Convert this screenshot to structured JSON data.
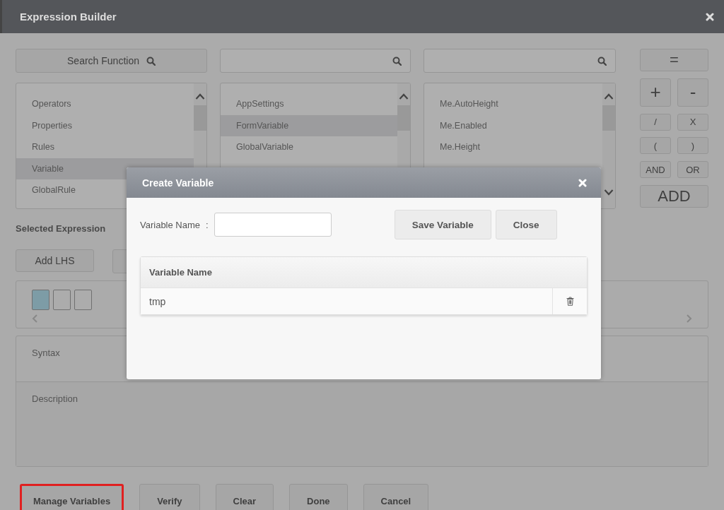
{
  "window": {
    "title": "Expression Builder"
  },
  "search_function": {
    "label": "Search Function"
  },
  "lists": [
    {
      "items": [
        {
          "label": "Operators",
          "selected": false
        },
        {
          "label": "Properties",
          "selected": false
        },
        {
          "label": "Rules",
          "selected": false
        },
        {
          "label": "Variable",
          "selected": true
        },
        {
          "label": "GlobalRule",
          "selected": false
        }
      ]
    },
    {
      "items": [
        {
          "label": "AppSettings",
          "selected": false
        },
        {
          "label": "FormVariable",
          "selected": true
        },
        {
          "label": "GlobalVariable",
          "selected": false
        }
      ]
    },
    {
      "items": [
        {
          "label": "Me.AutoHeight",
          "selected": false
        },
        {
          "label": "Me.Enabled",
          "selected": false
        },
        {
          "label": "Me.Height",
          "selected": false
        }
      ]
    }
  ],
  "operators": [
    {
      "label": "=",
      "kind": "wide"
    },
    {
      "label": "+",
      "kind": "big"
    },
    {
      "label": "-",
      "kind": "big"
    },
    {
      "label": "/",
      "kind": "small"
    },
    {
      "label": "X",
      "kind": "small"
    },
    {
      "label": "(",
      "kind": "small"
    },
    {
      "label": ")",
      "kind": "small"
    },
    {
      "label": "AND",
      "kind": "small"
    },
    {
      "label": "OR",
      "kind": "small"
    },
    {
      "label": "ADD",
      "kind": "wide"
    }
  ],
  "selected_expression": {
    "label": "Selected Expression",
    "buttons": [
      "Add LHS"
    ],
    "slots": [
      {
        "selected": true
      },
      {
        "selected": false
      },
      {
        "selected": false
      }
    ]
  },
  "syntax_label": "Syntax",
  "description_label": "Description",
  "footer_buttons": [
    {
      "label": "Manage Variables",
      "highlighted": true
    },
    {
      "label": "Verify",
      "highlighted": false
    },
    {
      "label": "Clear",
      "highlighted": false
    },
    {
      "label": "Done",
      "highlighted": false
    },
    {
      "label": "Cancel",
      "highlighted": false
    }
  ],
  "dialog": {
    "title": "Create Variable",
    "field_label": "Variable Name",
    "separator": ":",
    "buttons": [
      "Save Variable",
      "Close"
    ],
    "table": {
      "columns": [
        "Variable Name"
      ],
      "rows": [
        [
          "tmp"
        ]
      ]
    }
  }
}
